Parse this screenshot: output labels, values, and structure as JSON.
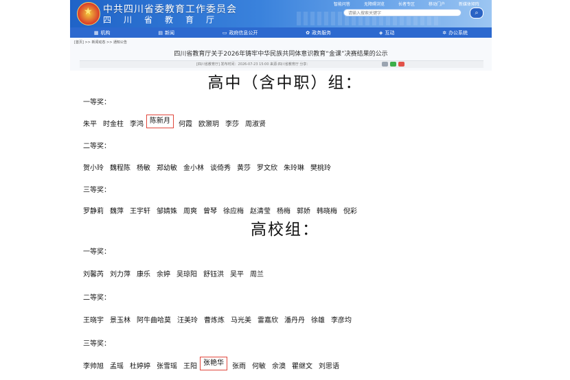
{
  "header": {
    "org_name": "中共四川省委教育工作委员会",
    "org_sub": "四川省教育厅",
    "top_links": [
      "智能问答",
      "无障碍浏览",
      "长者专区",
      "移动门户",
      "新媒体矩阵"
    ],
    "search_placeholder": "请输入搜索关键字"
  },
  "nav": {
    "items": [
      {
        "label": "机构",
        "icon": "building-icon"
      },
      {
        "label": "新闻",
        "icon": "news-icon"
      },
      {
        "label": "政府信息公开",
        "icon": "folder-icon"
      },
      {
        "label": "政务服务",
        "icon": "service-icon"
      },
      {
        "label": "互动",
        "icon": "chat-icon"
      },
      {
        "label": "办公系统",
        "icon": "gear-icon"
      }
    ]
  },
  "breadcrumb": "[首页] >> 新闻动态 >> 通知公告",
  "article": {
    "title": "四川省教育厅关于2026年铸牢中华民族共同体意识教育“金课”决赛结果的公示",
    "meta": "[四川省教育厅]  发布时间：2026-07-23 15:00  来源:四川省教育厅    分享："
  },
  "sections": [
    {
      "title": "高中（含中职）组：",
      "levels": [
        {
          "label": "一等奖：",
          "names": [
            "朱平",
            "时金柱",
            "李鸿",
            "陈新月",
            "何霞",
            "欧灏玥",
            "李莎",
            "周淑贤"
          ],
          "highlight": 3
        },
        {
          "label": "二等奖：",
          "names": [
            "贺小玲",
            "魏程陈",
            "杨敏",
            "郑幼敏",
            "金小林",
            "谈倚秀",
            "黄莎",
            "罗文欣",
            "朱玲琳",
            "樊桃玲"
          ],
          "highlight": -1
        },
        {
          "label": "三等奖：",
          "names": [
            "罗静莉",
            "魏萍",
            "王宇轩",
            "邹婧姝",
            "周爽",
            "曾琴",
            "徐应梅",
            "赵清莹",
            "杨梅",
            "郭娇",
            "韩晓梅",
            "倪彩"
          ],
          "highlight": -1
        }
      ]
    },
    {
      "title": "高校组：",
      "levels": [
        {
          "label": "一等奖：",
          "names": [
            "刘馨芮",
            "刘力萍",
            "康乐",
            "余婷",
            "吴琼阳",
            "舒钰洪",
            "吴平",
            "周兰"
          ],
          "highlight": -1
        },
        {
          "label": "二等奖：",
          "names": [
            "王晓宇",
            "景玉林",
            "阿牛曲哈莫",
            "汪美玲",
            "曹炼炼",
            "马光美",
            "雷嘉欣",
            "潘丹丹",
            "徐雄",
            "李彦均"
          ],
          "highlight": -1
        },
        {
          "label": "三等奖：",
          "names": [
            "李帅旭",
            "孟瑶",
            "杜婷婷",
            "张雪瑶",
            "王阳",
            "张艳华",
            "张雨",
            "何敏",
            "余澳",
            "瞿继文",
            "刘思语"
          ],
          "highlight": 5
        }
      ]
    }
  ],
  "colors": {
    "nav_blue": "#2c69cf",
    "highlight_red": "#e0453a"
  }
}
